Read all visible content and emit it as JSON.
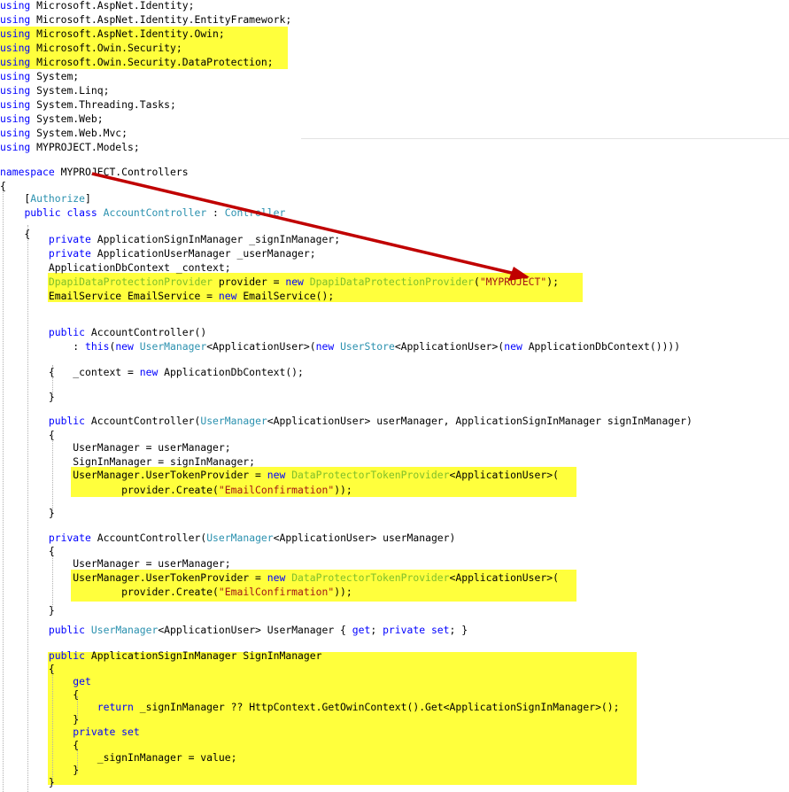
{
  "code": {
    "lines": [
      [
        {
          "t": "using",
          "c": "kw"
        },
        {
          "t": " Microsoft.AspNet.Identity;",
          "c": ""
        }
      ],
      [
        {
          "t": "using",
          "c": "kw"
        },
        {
          "t": " Microsoft.AspNet.Identity.EntityFramework;",
          "c": ""
        }
      ],
      [
        {
          "t": "using",
          "c": "kw"
        },
        {
          "t": " Microsoft.AspNet.Identity.Owin;",
          "c": ""
        }
      ],
      [
        {
          "t": "using",
          "c": "kw"
        },
        {
          "t": " Microsoft.Owin.Security;",
          "c": ""
        }
      ],
      [
        {
          "t": "using",
          "c": "kw"
        },
        {
          "t": " Microsoft.Owin.Security.DataProtection;",
          "c": ""
        }
      ],
      [
        {
          "t": "using",
          "c": "kw"
        },
        {
          "t": " System;",
          "c": ""
        }
      ],
      [
        {
          "t": "using",
          "c": "kw"
        },
        {
          "t": " System.Linq;",
          "c": ""
        }
      ],
      [
        {
          "t": "using",
          "c": "kw"
        },
        {
          "t": " System.Threading.Tasks;",
          "c": ""
        }
      ],
      [
        {
          "t": "using",
          "c": "kw"
        },
        {
          "t": " System.Web;",
          "c": ""
        }
      ],
      [
        {
          "t": "using",
          "c": "kw"
        },
        {
          "t": " System.Web.Mvc;",
          "c": ""
        }
      ],
      [
        {
          "t": "using",
          "c": "kw"
        },
        {
          "t": " MYPROJECT.Models;",
          "c": ""
        }
      ],
      [
        {
          "t": "namespace",
          "c": "kw"
        },
        {
          "t": " MYPROJECT.Controllers",
          "c": ""
        }
      ],
      [
        {
          "t": "{",
          "c": ""
        }
      ],
      [
        {
          "t": "    [",
          "c": ""
        },
        {
          "t": "Authorize",
          "c": "ty"
        },
        {
          "t": "]",
          "c": ""
        }
      ],
      [
        {
          "t": "    ",
          "c": ""
        },
        {
          "t": "public",
          "c": "kw"
        },
        {
          "t": " ",
          "c": ""
        },
        {
          "t": "class",
          "c": "kw"
        },
        {
          "t": " ",
          "c": ""
        },
        {
          "t": "AccountController",
          "c": "ty"
        },
        {
          "t": " : ",
          "c": ""
        },
        {
          "t": "Controller",
          "c": "ty"
        }
      ],
      [
        {
          "t": "    {",
          "c": ""
        }
      ],
      [
        {
          "t": "        ",
          "c": ""
        },
        {
          "t": "private",
          "c": "kw"
        },
        {
          "t": " ApplicationSignInManager _signInManager;",
          "c": ""
        }
      ],
      [
        {
          "t": "        ",
          "c": ""
        },
        {
          "t": "private",
          "c": "kw"
        },
        {
          "t": " ApplicationUserManager _userManager;",
          "c": ""
        }
      ],
      [
        {
          "t": "        ApplicationDbContext _context;",
          "c": ""
        }
      ],
      [
        {
          "t": "        ",
          "c": ""
        },
        {
          "t": "DpapiDataProtectionProvider",
          "c": "dim"
        },
        {
          "t": " provider = ",
          "c": ""
        },
        {
          "t": "new",
          "c": "kw"
        },
        {
          "t": " ",
          "c": ""
        },
        {
          "t": "DpapiDataProtectionProvider",
          "c": "dim"
        },
        {
          "t": "(",
          "c": ""
        },
        {
          "t": "\"MYPROJECT\"",
          "c": "str"
        },
        {
          "t": ");",
          "c": ""
        }
      ],
      [
        {
          "t": "        EmailService EmailService = ",
          "c": ""
        },
        {
          "t": "new",
          "c": "kw"
        },
        {
          "t": " EmailService();",
          "c": ""
        }
      ],
      [
        {
          "t": "        ",
          "c": ""
        },
        {
          "t": "public",
          "c": "kw"
        },
        {
          "t": " AccountController()",
          "c": ""
        }
      ],
      [
        {
          "t": "            : ",
          "c": ""
        },
        {
          "t": "this",
          "c": "kw"
        },
        {
          "t": "(",
          "c": ""
        },
        {
          "t": "new",
          "c": "kw"
        },
        {
          "t": " ",
          "c": ""
        },
        {
          "t": "UserManager",
          "c": "ty"
        },
        {
          "t": "<ApplicationUser>(",
          "c": ""
        },
        {
          "t": "new",
          "c": "kw"
        },
        {
          "t": " ",
          "c": ""
        },
        {
          "t": "UserStore",
          "c": "ty"
        },
        {
          "t": "<ApplicationUser>(",
          "c": ""
        },
        {
          "t": "new",
          "c": "kw"
        },
        {
          "t": " ApplicationDbContext())))",
          "c": ""
        }
      ],
      [
        {
          "t": "        {",
          "c": ""
        }
      ],
      [
        {
          "t": "            _context = ",
          "c": ""
        },
        {
          "t": "new",
          "c": "kw"
        },
        {
          "t": " ApplicationDbContext();",
          "c": ""
        }
      ],
      [
        {
          "t": "        }",
          "c": ""
        }
      ],
      [
        {
          "t": "        ",
          "c": ""
        },
        {
          "t": "public",
          "c": "kw"
        },
        {
          "t": " AccountController(",
          "c": ""
        },
        {
          "t": "UserManager",
          "c": "ty"
        },
        {
          "t": "<ApplicationUser> userManager, ApplicationSignInManager signInManager)",
          "c": ""
        }
      ],
      [
        {
          "t": "        {",
          "c": ""
        }
      ],
      [
        {
          "t": "            UserManager = userManager;",
          "c": ""
        }
      ],
      [
        {
          "t": "            SignInManager = signInManager;",
          "c": ""
        }
      ],
      [
        {
          "t": "            UserManager.UserTokenProvider = ",
          "c": ""
        },
        {
          "t": "new",
          "c": "kw"
        },
        {
          "t": " ",
          "c": ""
        },
        {
          "t": "DataProtectorTokenProvider",
          "c": "dim"
        },
        {
          "t": "<ApplicationUser>(",
          "c": ""
        }
      ],
      [
        {
          "t": "                    provider.Create(",
          "c": ""
        },
        {
          "t": "\"EmailConfirmation\"",
          "c": "str"
        },
        {
          "t": "));",
          "c": ""
        }
      ],
      [
        {
          "t": "        }",
          "c": ""
        }
      ],
      [
        {
          "t": "        ",
          "c": ""
        },
        {
          "t": "private",
          "c": "kw"
        },
        {
          "t": " AccountController(",
          "c": ""
        },
        {
          "t": "UserManager",
          "c": "ty"
        },
        {
          "t": "<ApplicationUser> userManager)",
          "c": ""
        }
      ],
      [
        {
          "t": "        {",
          "c": ""
        }
      ],
      [
        {
          "t": "            UserManager = userManager;",
          "c": ""
        }
      ],
      [
        {
          "t": "            UserManager.UserTokenProvider = ",
          "c": ""
        },
        {
          "t": "new",
          "c": "kw"
        },
        {
          "t": " ",
          "c": ""
        },
        {
          "t": "DataProtectorTokenProvider",
          "c": "dim"
        },
        {
          "t": "<ApplicationUser>(",
          "c": ""
        }
      ],
      [
        {
          "t": "                    provider.Create(",
          "c": ""
        },
        {
          "t": "\"EmailConfirmation\"",
          "c": "str"
        },
        {
          "t": "));",
          "c": ""
        }
      ],
      [
        {
          "t": "        }",
          "c": ""
        }
      ],
      [
        {
          "t": "        ",
          "c": ""
        },
        {
          "t": "public",
          "c": "kw"
        },
        {
          "t": " ",
          "c": ""
        },
        {
          "t": "UserManager",
          "c": "ty"
        },
        {
          "t": "<ApplicationUser> UserManager { ",
          "c": ""
        },
        {
          "t": "get",
          "c": "kw"
        },
        {
          "t": "; ",
          "c": ""
        },
        {
          "t": "private",
          "c": "kw"
        },
        {
          "t": " ",
          "c": ""
        },
        {
          "t": "set",
          "c": "kw"
        },
        {
          "t": "; }",
          "c": ""
        }
      ],
      [
        {
          "t": "        ",
          "c": ""
        },
        {
          "t": "public",
          "c": "kw"
        },
        {
          "t": " ApplicationSignInManager SignInManager",
          "c": ""
        }
      ],
      [
        {
          "t": "        {",
          "c": ""
        }
      ],
      [
        {
          "t": "            ",
          "c": ""
        },
        {
          "t": "get",
          "c": "kw"
        }
      ],
      [
        {
          "t": "            {",
          "c": ""
        }
      ],
      [
        {
          "t": "                ",
          "c": ""
        },
        {
          "t": "return",
          "c": "kw"
        },
        {
          "t": " _signInManager ?? HttpContext.GetOwinContext().Get<ApplicationSignInManager>();",
          "c": ""
        }
      ],
      [
        {
          "t": "            }",
          "c": ""
        }
      ],
      [
        {
          "t": "            ",
          "c": ""
        },
        {
          "t": "private",
          "c": "kw"
        },
        {
          "t": " ",
          "c": ""
        },
        {
          "t": "set",
          "c": "kw"
        }
      ],
      [
        {
          "t": "            {",
          "c": ""
        }
      ],
      [
        {
          "t": "                _signInManager = value;",
          "c": ""
        }
      ],
      [
        {
          "t": "            }",
          "c": ""
        }
      ],
      [
        {
          "t": "        }",
          "c": ""
        }
      ]
    ]
  },
  "colors": {
    "keyword": "#0000ff",
    "type": "#2b91af",
    "string": "#a31515",
    "highlight": "#ffff3c",
    "arrow": "#c00000"
  },
  "annotation": {
    "kind": "red-arrow",
    "points_to": "\"MYPROJECT\""
  }
}
